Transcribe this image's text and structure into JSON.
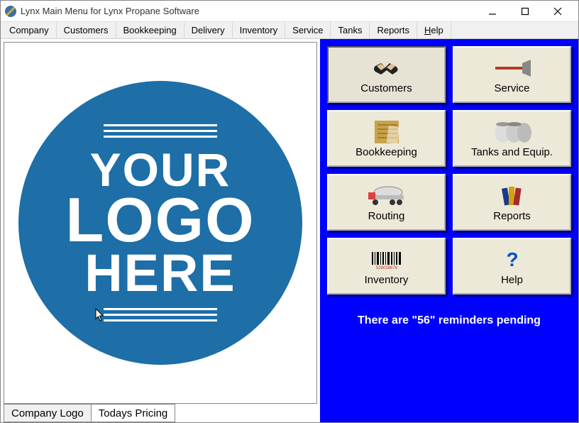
{
  "window": {
    "title": "Lynx Main Menu for Lynx Propane Software"
  },
  "menubar": [
    "Company",
    "Customers",
    "Bookkeeping",
    "Delivery",
    "Inventory",
    "Service",
    "Tanks",
    "Reports",
    "Help"
  ],
  "logo": {
    "line1": "YOUR",
    "line2": "LOGO",
    "line3": "HERE"
  },
  "tabs": {
    "company_logo": "Company Logo",
    "todays_pricing": "Todays Pricing"
  },
  "tiles": {
    "customers": "Customers",
    "service": "Service",
    "bookkeeping": "Bookkeeping",
    "tanks_equip": "Tanks and Equip.",
    "routing": "Routing",
    "reports": "Reports",
    "inventory": "Inventory",
    "help": "Help"
  },
  "reminders_text": "There are \"56\" reminders pending"
}
